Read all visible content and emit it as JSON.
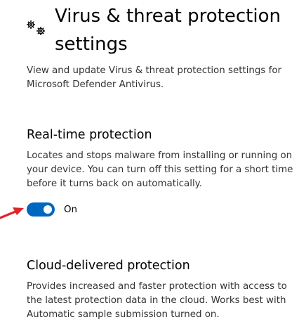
{
  "header": {
    "icon": "gear-icon",
    "title_line1": "Virus & threat protection",
    "title_line2": "settings",
    "description_line1": "View and update Virus & threat protection settings for",
    "description_line2": "Microsoft Defender Antivirus."
  },
  "realtime": {
    "title": "Real-time protection",
    "description_line1": "Locates and stops malware from installing or running on",
    "description_line2": "your device. You can turn off this setting for a short time",
    "description_line3": "before it turns back on automatically.",
    "toggle_state": "On",
    "toggle_on": true
  },
  "cloud": {
    "title": "Cloud-delivered protection",
    "description_line1": "Provides increased and faster protection with access to",
    "description_line2": "the latest protection data in the cloud. Works best with",
    "description_line3": "Automatic sample submission turned on."
  },
  "annotation": {
    "arrow_icon": "red-arrow-icon",
    "arrow_color": "#e0242b"
  },
  "colors": {
    "accent": "#0067c0",
    "text": "#000000",
    "secondary_text": "#333333"
  }
}
